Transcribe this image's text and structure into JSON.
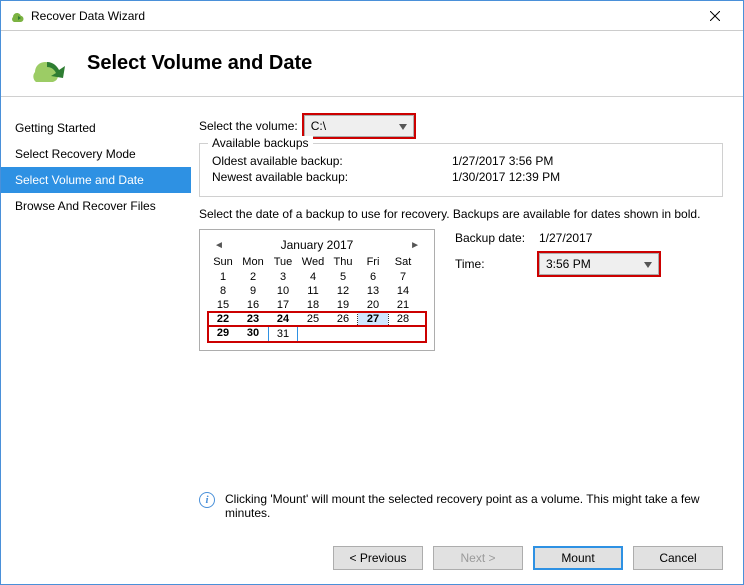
{
  "window": {
    "title": "Recover Data Wizard"
  },
  "header": {
    "title": "Select Volume and Date"
  },
  "sidebar": {
    "items": [
      {
        "label": "Getting Started"
      },
      {
        "label": "Select Recovery Mode"
      },
      {
        "label": "Select Volume and Date"
      },
      {
        "label": "Browse And Recover Files"
      }
    ]
  },
  "volume": {
    "label": "Select the volume:",
    "value": "C:\\"
  },
  "backups": {
    "legend": "Available backups",
    "oldest_label": "Oldest available backup:",
    "oldest_value": "1/27/2017 3:56 PM",
    "newest_label": "Newest available backup:",
    "newest_value": "1/30/2017 12:39 PM"
  },
  "instruction": "Select the date of a backup to use for recovery. Backups are available for dates shown in bold.",
  "backup_date": {
    "label": "Backup date:",
    "value": "1/27/2017"
  },
  "time": {
    "label": "Time:",
    "value": "3:56 PM"
  },
  "calendar": {
    "month": "January 2017",
    "dow": [
      "Sun",
      "Mon",
      "Tue",
      "Wed",
      "Thu",
      "Fri",
      "Sat"
    ],
    "weeks": [
      [
        1,
        2,
        3,
        4,
        5,
        6,
        7
      ],
      [
        8,
        9,
        10,
        11,
        12,
        13,
        14
      ],
      [
        15,
        16,
        17,
        18,
        19,
        20,
        21
      ],
      [
        22,
        23,
        24,
        25,
        26,
        27,
        28
      ],
      [
        29,
        30,
        31,
        null,
        null,
        null,
        null
      ]
    ],
    "bold_days": [
      22,
      23,
      24,
      29,
      30
    ],
    "selected_day": 27,
    "today": 31
  },
  "info": "Clicking 'Mount' will mount the selected recovery point as a volume. This might take a few minutes.",
  "buttons": {
    "previous": "< Previous",
    "next": "Next >",
    "mount": "Mount",
    "cancel": "Cancel"
  }
}
